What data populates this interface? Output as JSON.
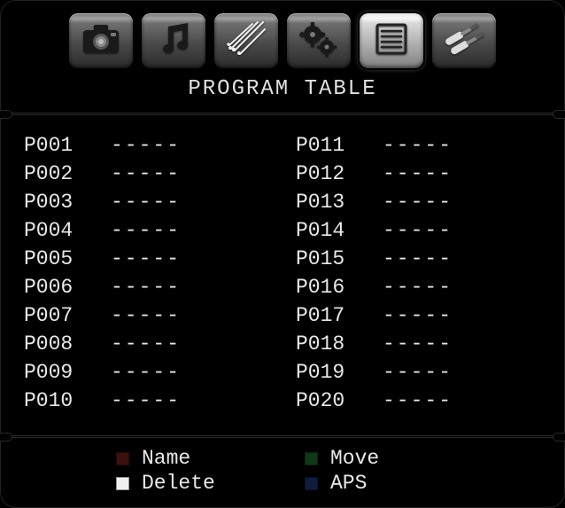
{
  "title": "PROGRAM TABLE",
  "tabs": [
    {
      "name": "picture-tab",
      "icon": "camera",
      "active": false
    },
    {
      "name": "sound-tab",
      "icon": "music",
      "active": false
    },
    {
      "name": "feature-tab",
      "icon": "sparks",
      "active": false
    },
    {
      "name": "install-tab",
      "icon": "gears",
      "active": false
    },
    {
      "name": "program-tab",
      "icon": "list",
      "active": true
    },
    {
      "name": "source-tab",
      "icon": "cables",
      "active": false
    }
  ],
  "empty_marker": "-----",
  "programs_left": [
    {
      "id": "P001",
      "name": "-----"
    },
    {
      "id": "P002",
      "name": "-----"
    },
    {
      "id": "P003",
      "name": "-----"
    },
    {
      "id": "P004",
      "name": "-----"
    },
    {
      "id": "P005",
      "name": "-----"
    },
    {
      "id": "P006",
      "name": "-----"
    },
    {
      "id": "P007",
      "name": "-----"
    },
    {
      "id": "P008",
      "name": "-----"
    },
    {
      "id": "P009",
      "name": "-----"
    },
    {
      "id": "P010",
      "name": "-----"
    }
  ],
  "programs_right": [
    {
      "id": "P011",
      "name": "-----"
    },
    {
      "id": "P012",
      "name": "-----"
    },
    {
      "id": "P013",
      "name": "-----"
    },
    {
      "id": "P014",
      "name": "-----"
    },
    {
      "id": "P015",
      "name": "-----"
    },
    {
      "id": "P016",
      "name": "-----"
    },
    {
      "id": "P017",
      "name": "-----"
    },
    {
      "id": "P018",
      "name": "-----"
    },
    {
      "id": "P019",
      "name": "-----"
    },
    {
      "id": "P020",
      "name": "-----"
    }
  ],
  "legend": {
    "name": {
      "label": "Name",
      "color_desc": "red",
      "color": "#b03030",
      "dim": true
    },
    "move": {
      "label": "Move",
      "color_desc": "green",
      "color": "#30a040",
      "dim": true
    },
    "delete": {
      "label": "Delete",
      "color_desc": "yellow",
      "color": "#f0f0f0",
      "dim": false
    },
    "aps": {
      "label": "APS",
      "color_desc": "blue",
      "color": "#3050b0",
      "dim": true
    }
  }
}
